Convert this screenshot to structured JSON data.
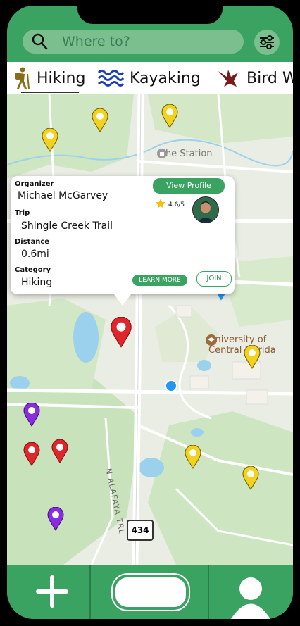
{
  "search": {
    "placeholder": "Where to?"
  },
  "tabs": [
    {
      "label": "Hiking",
      "icon": "hiker-icon",
      "selected": true
    },
    {
      "label": "Kayaking",
      "icon": "waves-icon"
    },
    {
      "label": "Bird W",
      "icon": "bird-icon"
    }
  ],
  "map": {
    "places": [
      "The Station",
      "University of Central Florida"
    ],
    "road_label": "N ALAFAYA TRL",
    "route_shield": "434"
  },
  "popup": {
    "organizer_label": "Organizer",
    "organizer": "Michael McGarvey",
    "view_profile": "View Profile",
    "rating": "4.6/5",
    "trip_label": "Trip",
    "trip": "Shingle Creek Trail",
    "distance_label": "Distance",
    "distance": "0.6mi",
    "category_label": "Category",
    "category": "Hiking",
    "learn_more": "LEARN MORE",
    "join": "JOIN"
  },
  "colors": {
    "brand": "#3aa361",
    "pin_red": "#e0262b",
    "pin_yellow": "#f2d21b",
    "pin_purple": "#8a2be2"
  }
}
